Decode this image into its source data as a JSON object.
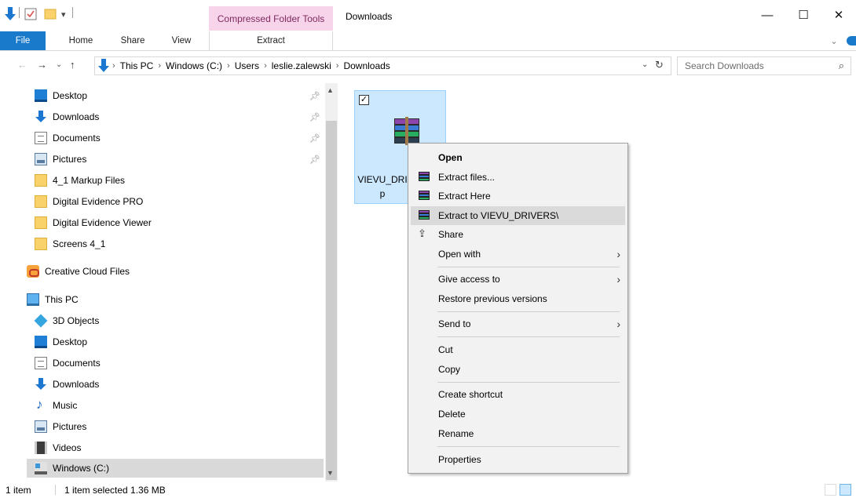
{
  "titlebar": {
    "context_tab_header": "Compressed Folder Tools",
    "title": "Downloads",
    "minimize": "—",
    "maximize": "☐",
    "close": "✕"
  },
  "ribbon": {
    "tabs": [
      "File",
      "Home",
      "Share",
      "View",
      "Extract"
    ]
  },
  "address": {
    "breadcrumbs": [
      "This PC",
      "Windows (C:)",
      "Users",
      "leslie.zalewski",
      "Downloads"
    ],
    "search_placeholder": "Search Downloads"
  },
  "navpane": {
    "quick_access": [
      {
        "label": "Desktop",
        "icon": "desktop-icon",
        "pinned": true
      },
      {
        "label": "Downloads",
        "icon": "downloads-icon",
        "pinned": true
      },
      {
        "label": "Documents",
        "icon": "documents-icon",
        "pinned": true
      },
      {
        "label": "Pictures",
        "icon": "pictures-icon",
        "pinned": true
      },
      {
        "label": "4_1 Markup Files",
        "icon": "folder-icon"
      },
      {
        "label": "Digital Evidence PRO",
        "icon": "folder-icon"
      },
      {
        "label": "Digital Evidence Viewer",
        "icon": "folder-icon"
      },
      {
        "label": "Screens 4_1",
        "icon": "folder-icon"
      }
    ],
    "creative_cloud": "Creative Cloud Files",
    "this_pc": "This PC",
    "this_pc_items": [
      {
        "label": "3D Objects",
        "icon": "3d-objects-icon"
      },
      {
        "label": "Desktop",
        "icon": "desktop-icon"
      },
      {
        "label": "Documents",
        "icon": "documents-icon"
      },
      {
        "label": "Downloads",
        "icon": "downloads-icon"
      },
      {
        "label": "Music",
        "icon": "music-icon"
      },
      {
        "label": "Pictures",
        "icon": "pictures-icon"
      },
      {
        "label": "Videos",
        "icon": "videos-icon"
      },
      {
        "label": "Windows (C:)",
        "icon": "drive-icon",
        "selected": true
      }
    ]
  },
  "file": {
    "name_line1": "VIEVU_DRI",
    "name_line2": "p",
    "checked": true
  },
  "context_menu": {
    "open": "Open",
    "extract_files": "Extract files...",
    "extract_here": "Extract Here",
    "extract_to": "Extract to VIEVU_DRIVERS\\",
    "share": "Share",
    "open_with": "Open with",
    "give_access": "Give access to",
    "restore": "Restore previous versions",
    "send_to": "Send to",
    "cut": "Cut",
    "copy": "Copy",
    "create_shortcut": "Create shortcut",
    "delete": "Delete",
    "rename": "Rename",
    "properties": "Properties"
  },
  "statusbar": {
    "item_count": "1 item",
    "selection": "1 item selected  1.36 MB"
  },
  "colors": {
    "accent": "#1979ca",
    "context_tab": "#f7d4ea",
    "selection": "#cce8ff"
  }
}
